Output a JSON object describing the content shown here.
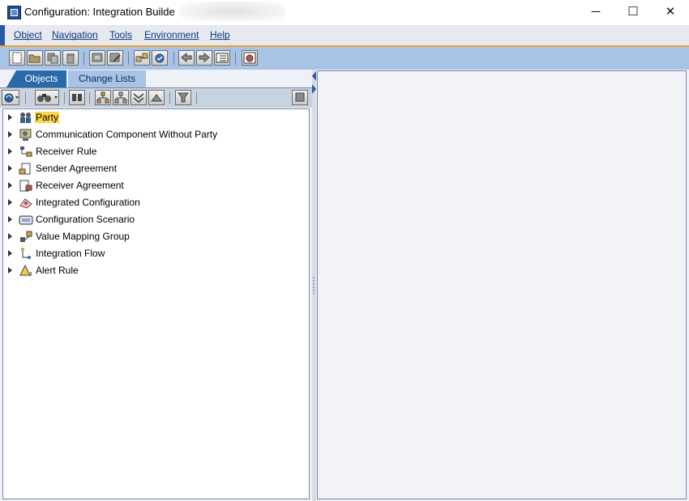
{
  "window": {
    "title": "Configuration: Integration Builde",
    "controls": {
      "minimize": "─",
      "maximize": "☐",
      "close": "✕"
    }
  },
  "menu": {
    "items": [
      "Object",
      "Navigation",
      "Tools",
      "Environment",
      "Help"
    ]
  },
  "toolbar": {
    "buttons": [
      "new-document-icon",
      "open-folder-icon",
      "copy-icon",
      "delete-icon",
      "display-icon",
      "edit-icon",
      "transport-icon",
      "check-icon",
      "back-icon",
      "forward-icon",
      "list-icon",
      "settings-icon"
    ]
  },
  "left_pane": {
    "tabs": [
      "Objects",
      "Change Lists"
    ],
    "tree": [
      {
        "label": "Party",
        "icon": "party-icon",
        "selected": true
      },
      {
        "label": "Communication Component Without Party",
        "icon": "communication-component-icon"
      },
      {
        "label": "Receiver Rule",
        "icon": "receiver-rule-icon"
      },
      {
        "label": "Sender Agreement",
        "icon": "sender-agreement-icon"
      },
      {
        "label": "Receiver Agreement",
        "icon": "receiver-agreement-icon"
      },
      {
        "label": "Integrated Configuration",
        "icon": "integrated-configuration-icon"
      },
      {
        "label": "Configuration Scenario",
        "icon": "configuration-scenario-icon"
      },
      {
        "label": "Value Mapping Group",
        "icon": "value-mapping-group-icon"
      },
      {
        "label": "Integration Flow",
        "icon": "integration-flow-icon"
      },
      {
        "label": "Alert Rule",
        "icon": "alert-rule-icon"
      }
    ]
  },
  "colors": {
    "toolbar_bg": "#a9c3e6",
    "accent_orange": "#f0a12c",
    "active_tab": "#2a6aa8",
    "selection": "#ffd34a",
    "menu_text": "#10347a"
  }
}
